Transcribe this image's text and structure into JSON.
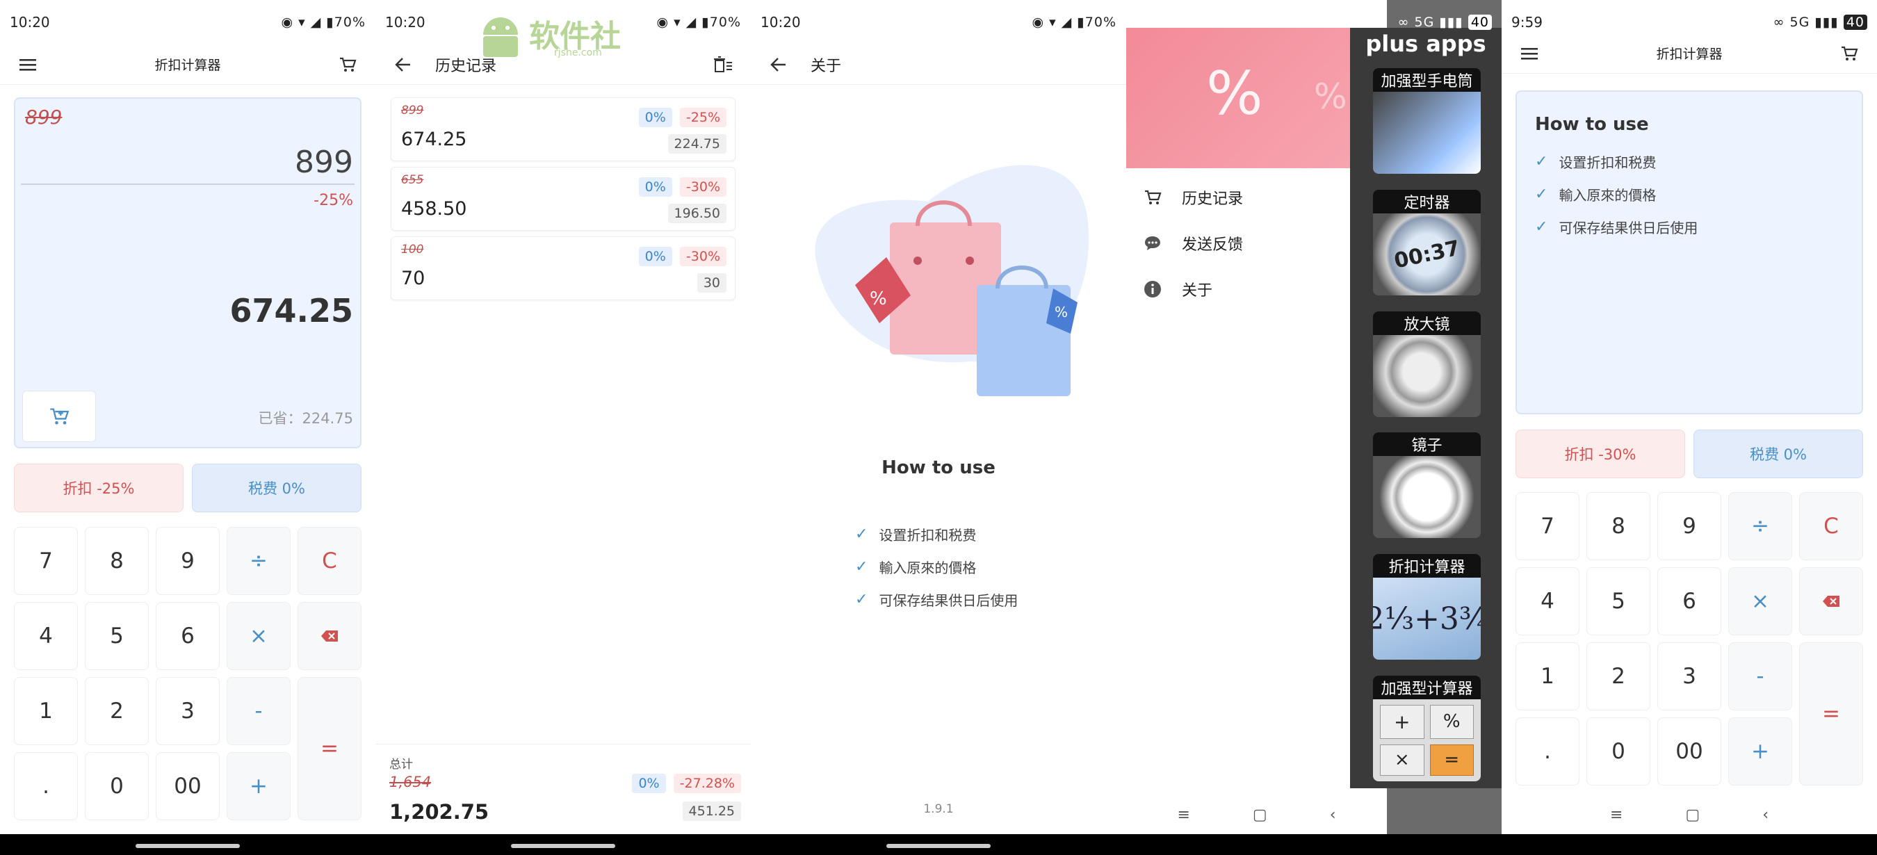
{
  "status": {
    "p1_time": "10:20",
    "p2_time": "10:20",
    "p3_time": "10:20",
    "p4_time": "9:59",
    "p5_time": "9:59",
    "battery_70": "70%",
    "net_5g": "5G",
    "battery_40": "40"
  },
  "watermark": {
    "text": "软件社",
    "sub": "rjshe.com"
  },
  "calc1": {
    "title": "折扣计算器",
    "original_struck": "899",
    "input_value": "899",
    "discount_pct": "-25%",
    "result": "674.25",
    "saved": "已省：224.75",
    "discount_btn": "折扣 -25%",
    "tax_btn": "税费 0%"
  },
  "keys": {
    "k7": "7",
    "k8": "8",
    "k9": "9",
    "div": "÷",
    "clear": "C",
    "k4": "4",
    "k5": "5",
    "k6": "6",
    "mul": "×",
    "k1": "1",
    "k2": "2",
    "k3": "3",
    "minus": "-",
    "eq": "=",
    "dot": ".",
    "k0": "0",
    "k00": "00",
    "plus": "+"
  },
  "history": {
    "title": "历史记录",
    "items": [
      {
        "original": "899",
        "result": "674.25",
        "tax": "0%",
        "discount": "-25%",
        "saved": "224.75"
      },
      {
        "original": "655",
        "result": "458.50",
        "tax": "0%",
        "discount": "-30%",
        "saved": "196.50"
      },
      {
        "original": "100",
        "result": "70",
        "tax": "0%",
        "discount": "-30%",
        "saved": "30"
      }
    ],
    "total_label": "总计",
    "total_original": "1,654",
    "total_result": "1,202.75",
    "total_tax": "0%",
    "total_discount": "-27.28%",
    "total_saved": "451.25"
  },
  "about": {
    "title": "关于",
    "heading": "How to use",
    "steps": [
      "设置折扣和税费",
      "輸入原來的價格",
      "可保存结果供日后使用"
    ],
    "version": "1.9.1"
  },
  "drawer": {
    "plus_apps": "plus apps",
    "items": [
      "历史记录",
      "发送反馈",
      "关于"
    ],
    "apps": [
      "加强型手电筒",
      "定时器",
      "放大镜",
      "镜子",
      "折扣计算器",
      "加强型计算器"
    ],
    "timer_face": "00:37"
  },
  "calc2": {
    "title": "折扣计算器",
    "heading": "How to use",
    "steps": [
      "设置折扣和税费",
      "輸入原來的價格",
      "可保存结果供日后使用"
    ],
    "discount_btn": "折扣 -30%",
    "tax_btn": "税费 0%"
  },
  "colors": {
    "accent_blue": "#4a8fc4",
    "accent_red": "#d35050",
    "display_bg": "#eef4ff"
  }
}
